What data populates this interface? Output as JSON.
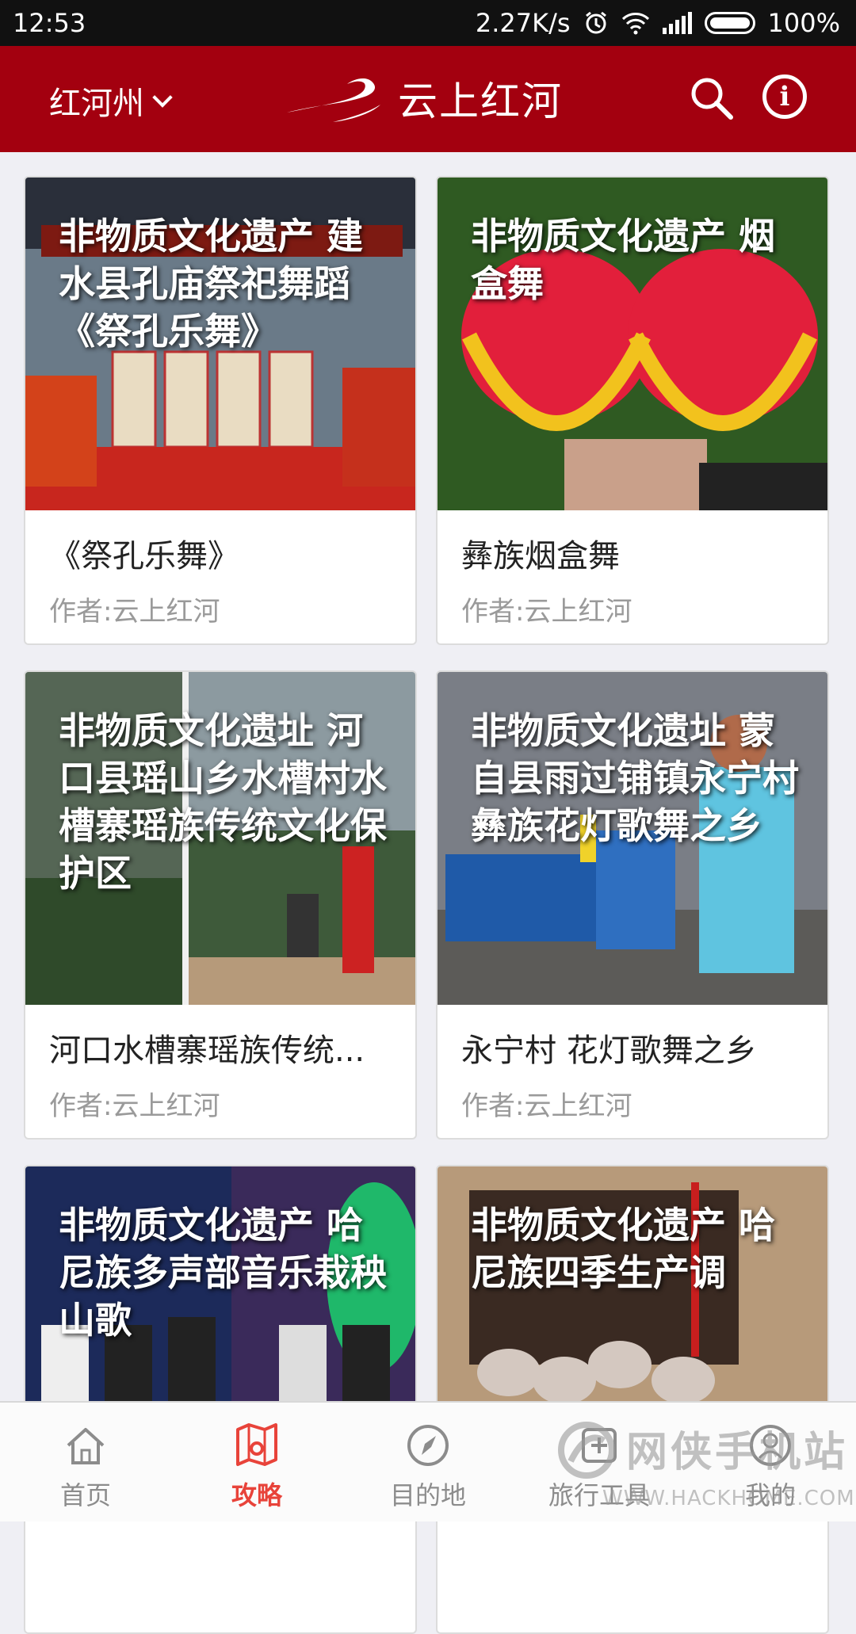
{
  "status_bar": {
    "time": "12:53",
    "net_speed": "2.27K/s",
    "battery": "100%"
  },
  "header": {
    "region": "红河州",
    "app_title": "云上红河",
    "colors": {
      "bar": "#a3000f",
      "accent": "#e8433a"
    }
  },
  "cards": [
    {
      "overlay": "非物质文化遗产 建水县孔庙祭祀舞蹈《祭孔乐舞》",
      "title": "《祭孔乐舞》",
      "author": "作者:云上红河"
    },
    {
      "overlay": "非物质文化遗产 烟盒舞",
      "title": "彝族烟盒舞",
      "author": "作者:云上红河"
    },
    {
      "overlay": "非物质文化遗址 河口县瑶山乡水槽村水槽寨瑶族传统文化保护区",
      "title": "河口水槽寨瑶族传统...",
      "author": "作者:云上红河"
    },
    {
      "overlay": "非物质文化遗址 蒙自县雨过铺镇永宁村彝族花灯歌舞之乡",
      "title": "永宁村 花灯歌舞之乡",
      "author": "作者:云上红河"
    },
    {
      "overlay": "非物质文化遗产 哈尼族多声部音乐栽秧山歌",
      "title": "",
      "author": ""
    },
    {
      "overlay": "非物质文化遗产 哈尼族四季生产调",
      "title": "",
      "author": ""
    }
  ],
  "tabs": [
    {
      "label": "首页",
      "icon": "home-icon"
    },
    {
      "label": "攻略",
      "icon": "map-pin-icon",
      "active": true
    },
    {
      "label": "目的地",
      "icon": "compass-icon"
    },
    {
      "label": "旅行工具",
      "icon": "tools-icon"
    },
    {
      "label": "我的",
      "icon": "user-icon"
    }
  ],
  "watermark": {
    "text": "网侠手机站",
    "url": "WWW.HACKHOME.COM"
  }
}
